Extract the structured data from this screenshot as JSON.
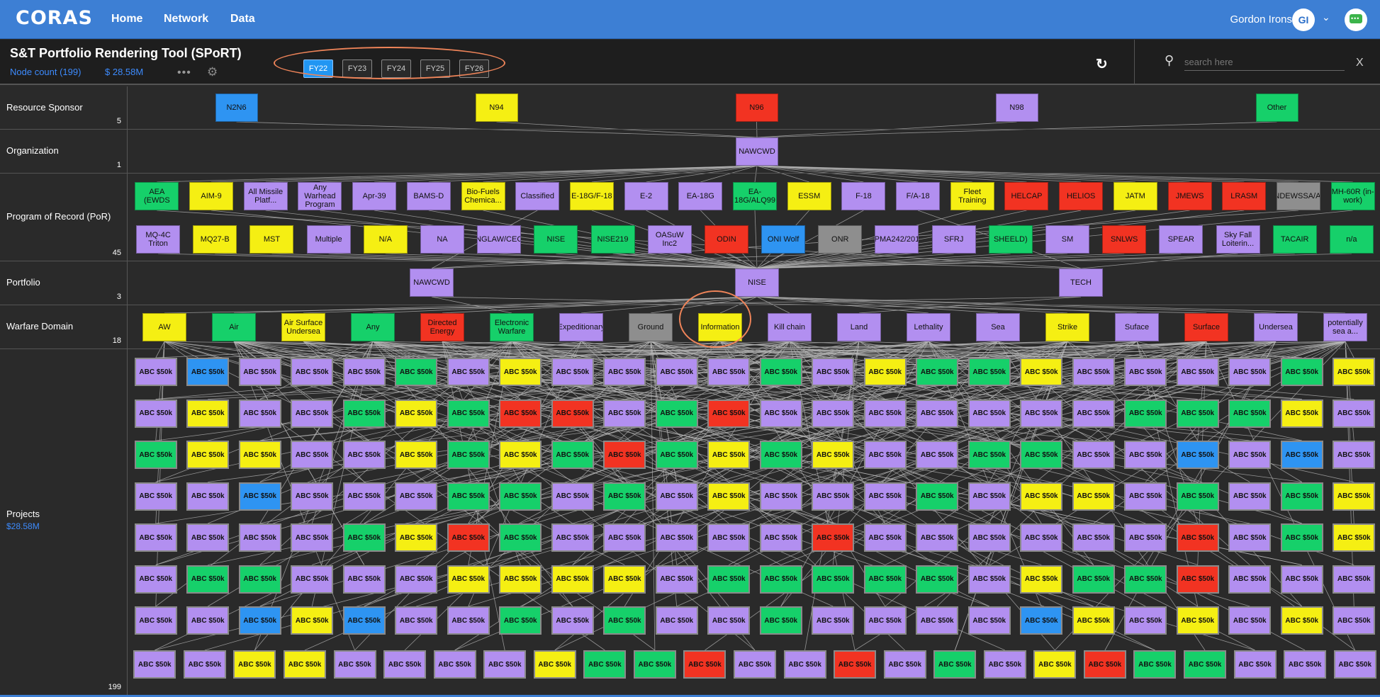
{
  "app": {
    "logo": "CORAS",
    "nav": [
      "Home",
      "Network",
      "Data"
    ],
    "user_name": "Gordon Irons",
    "user_initials": "GI"
  },
  "header": {
    "title": "S&T Portfolio Rendering Tool (SPoRT)",
    "node_count": "Node count (199)",
    "total": "$ 28.58M",
    "more": "•••",
    "gear": "gear-icon"
  },
  "fiscal_years": [
    {
      "label": "FY22",
      "active": true
    },
    {
      "label": "FY23",
      "active": false
    },
    {
      "label": "FY24",
      "active": false
    },
    {
      "label": "FY25",
      "active": false
    },
    {
      "label": "FY26",
      "active": false
    }
  ],
  "search": {
    "placeholder": "search here",
    "close": "X"
  },
  "colors": {
    "purple": "#b28ff0",
    "yellow": "#f5ef13",
    "red": "#f23322",
    "green": "#16d06a",
    "blue": "#2e94f2",
    "gray": "#8e8e8e",
    "link": "#b8b8b8",
    "highlight": "#ef8459"
  },
  "lanes": [
    {
      "name": "Resource Sponsor",
      "count": "5"
    },
    {
      "name": "Organization",
      "count": "1"
    },
    {
      "name": "Program of Record (PoR)",
      "count": "45"
    },
    {
      "name": "Portfolio",
      "count": "3"
    },
    {
      "name": "Warfare Domain",
      "count": "18"
    },
    {
      "name": "Projects",
      "count": "199",
      "sub": "$28.58M"
    }
  ],
  "sponsors": [
    {
      "label": "N2N6",
      "color": "blue"
    },
    {
      "label": "N94",
      "color": "yellow"
    },
    {
      "label": "N96",
      "color": "red"
    },
    {
      "label": "N98",
      "color": "purple"
    },
    {
      "label": "Other",
      "color": "green"
    }
  ],
  "organizations": [
    {
      "label": "NAWCWD",
      "color": "purple"
    }
  ],
  "por_row1": [
    {
      "label": "AEA (EWDS",
      "color": "green"
    },
    {
      "label": "AIM-9",
      "color": "yellow"
    },
    {
      "label": "All Missile Platf...",
      "color": "purple"
    },
    {
      "label": "Any Warhead Program",
      "color": "purple"
    },
    {
      "label": "Apr-39",
      "color": "purple"
    },
    {
      "label": "BAMS-D",
      "color": "purple"
    },
    {
      "label": "Bio-Fuels Chemica...",
      "color": "yellow"
    },
    {
      "label": "Classified",
      "color": "purple"
    },
    {
      "label": "E-18G/F-18",
      "color": "yellow"
    },
    {
      "label": "E-2",
      "color": "purple"
    },
    {
      "label": "EA-18G",
      "color": "purple"
    },
    {
      "label": "EA-18G/ALQ99",
      "color": "green"
    },
    {
      "label": "ESSM",
      "color": "yellow"
    },
    {
      "label": "F-18",
      "color": "purple"
    },
    {
      "label": "F/A-18",
      "color": "purple"
    },
    {
      "label": "Fleet Training",
      "color": "yellow"
    },
    {
      "label": "HELCAP",
      "color": "red"
    },
    {
      "label": "HELIOS",
      "color": "red"
    },
    {
      "label": "JATM",
      "color": "yellow"
    },
    {
      "label": "JMEWS",
      "color": "red"
    },
    {
      "label": "LRASM",
      "color": "red"
    },
    {
      "label": "NDEWSSA/AI",
      "color": "gray"
    },
    {
      "label": "MH-60R (in-work)",
      "color": "green"
    }
  ],
  "por_row2": [
    {
      "label": "MQ-4C Triton",
      "color": "purple"
    },
    {
      "label": "MQ27-B",
      "color": "yellow"
    },
    {
      "label": "MST",
      "color": "yellow"
    },
    {
      "label": "Multiple",
      "color": "purple"
    },
    {
      "label": "N/A",
      "color": "yellow"
    },
    {
      "label": "NA",
      "color": "purple"
    },
    {
      "label": "NGLAW/CEC",
      "color": "purple"
    },
    {
      "label": "NISE",
      "color": "green"
    },
    {
      "label": "NISE219",
      "color": "green"
    },
    {
      "label": "OASuW Inc2",
      "color": "purple"
    },
    {
      "label": "ODIN",
      "color": "red"
    },
    {
      "label": "ONI Wolf",
      "color": "blue"
    },
    {
      "label": "ONR",
      "color": "gray"
    },
    {
      "label": "PMA242/201",
      "color": "purple"
    },
    {
      "label": "SFRJ",
      "color": "purple"
    },
    {
      "label": "SHEELD)",
      "color": "green"
    },
    {
      "label": "SM",
      "color": "purple"
    },
    {
      "label": "SNLWS",
      "color": "red"
    },
    {
      "label": "SPEAR",
      "color": "purple"
    },
    {
      "label": "Sky Fall Loiterin...",
      "color": "purple"
    },
    {
      "label": "TACAIR",
      "color": "green"
    },
    {
      "label": "n/a",
      "color": "green"
    }
  ],
  "portfolios": [
    {
      "label": "NAWCWD",
      "color": "purple"
    },
    {
      "label": "NISE",
      "color": "purple"
    },
    {
      "label": "TECH",
      "color": "purple"
    }
  ],
  "warfare_domains": [
    {
      "label": "AW",
      "color": "yellow"
    },
    {
      "label": "Air",
      "color": "green"
    },
    {
      "label": "Air Surface Undersea",
      "color": "yellow"
    },
    {
      "label": "Any",
      "color": "green"
    },
    {
      "label": "Directed Energy",
      "color": "red"
    },
    {
      "label": "Electronic Warfare",
      "color": "green"
    },
    {
      "label": "Expeditionary",
      "color": "purple"
    },
    {
      "label": "Ground",
      "color": "gray"
    },
    {
      "label": "Information",
      "color": "yellow"
    },
    {
      "label": "Kill chain",
      "color": "purple"
    },
    {
      "label": "Land",
      "color": "purple"
    },
    {
      "label": "Lethality",
      "color": "purple"
    },
    {
      "label": "Sea",
      "color": "purple"
    },
    {
      "label": "Strike",
      "color": "yellow"
    },
    {
      "label": "Suface",
      "color": "purple"
    },
    {
      "label": "Surface",
      "color": "red"
    },
    {
      "label": "Undersea",
      "color": "purple"
    },
    {
      "label": "potentially sea a...",
      "color": "purple"
    }
  ],
  "project_label": "ABC $50k",
  "project_rows": [
    "PBPPPGPYPPPPGPYGGYPPPPGY",
    "PYPPGYGRRPGRPPPPPPPGGGYP",
    "GYYPPYGYGRGYGYPPGGPPBPBP",
    "PPBPPPGGPGPYPPPGPYYPGPGY",
    "PPPPGYRGPPPPPRPPPPPPRPGY",
    "PGGPPPYYYYPGGGGGPYGGRPPP",
    "PPBYBPPGPGPPGPPPPBYPYPYP",
    "PPYYPPPPYGGRPPRPGPYRGGPPP"
  ]
}
